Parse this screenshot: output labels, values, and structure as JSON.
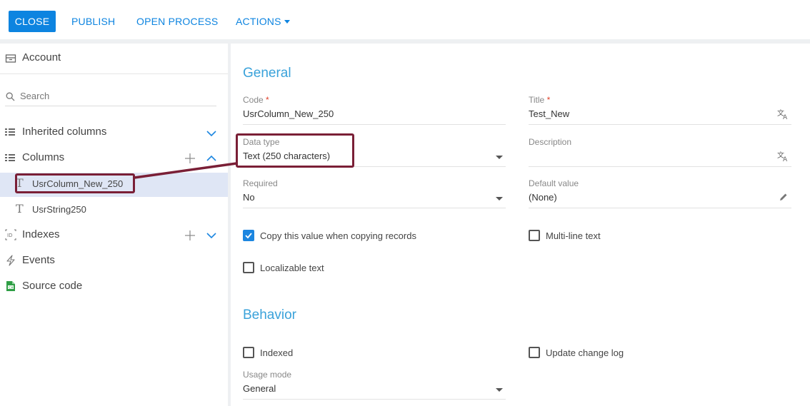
{
  "toolbar": {
    "close_label": "CLOSE",
    "publish_label": "PUBLISH",
    "open_process_label": "OPEN PROCESS",
    "actions_label": "ACTIONS"
  },
  "sidebar": {
    "title": "Account",
    "search_placeholder": "Search",
    "items": [
      {
        "label": "Inherited columns",
        "icon": "list-icon"
      },
      {
        "label": "Columns",
        "icon": "list-icon"
      },
      {
        "label": "UsrColumn_New_250",
        "icon": "text-type-icon",
        "selected": true
      },
      {
        "label": "UsrString250",
        "icon": "text-type-icon"
      },
      {
        "label": "Indexes",
        "icon": "index-icon"
      },
      {
        "label": "Events",
        "icon": "lightning-icon"
      },
      {
        "label": "Source code",
        "icon": "code-file-icon"
      }
    ]
  },
  "general": {
    "title": "General",
    "code": {
      "label": "Code",
      "required_mark": "*",
      "value": "UsrColumn_New_250"
    },
    "title_field": {
      "label": "Title",
      "required_mark": "*",
      "value": "Test_New"
    },
    "data_type": {
      "label": "Data type",
      "value": "Text (250 characters)"
    },
    "description": {
      "label": "Description",
      "value": ""
    },
    "required": {
      "label": "Required",
      "value": "No"
    },
    "default_value": {
      "label": "Default value",
      "value": "(None)"
    },
    "copy_value": {
      "label": "Copy this value when copying records",
      "checked": true
    },
    "multi_line": {
      "label": "Multi-line text",
      "checked": false
    },
    "localizable": {
      "label": "Localizable text",
      "checked": false
    }
  },
  "behavior": {
    "title": "Behavior",
    "indexed": {
      "label": "Indexed",
      "checked": false
    },
    "update_log": {
      "label": "Update change log",
      "checked": false
    },
    "usage_mode": {
      "label": "Usage mode",
      "value": "General"
    }
  },
  "colors": {
    "accent": "#0d84e0",
    "section_title": "#3aa2da",
    "highlight": "#7a1f36",
    "selected_row": "#dfe6f5"
  }
}
